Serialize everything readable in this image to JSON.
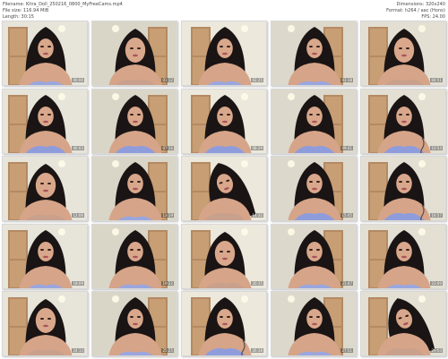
{
  "meta": {
    "filename": "Filename: Kitra_Doll_250216_0800_MyFreeCams.mp4",
    "filesize": "File size: 116.94 MiB",
    "length": "Length: 30:15",
    "dimensions": "Dimensions: 320x240",
    "format": "Format: h264 / aac (Hono)",
    "fps": "FPS: 24.00"
  },
  "thumbnails": [
    {
      "time": "00:00",
      "scene": "hair"
    },
    {
      "time": "01:12",
      "scene": "close"
    },
    {
      "time": "02:25",
      "scene": "room"
    },
    {
      "time": "03:38",
      "scene": "room"
    },
    {
      "time": "04:51",
      "scene": "close"
    },
    {
      "time": "06:03",
      "scene": "lace"
    },
    {
      "time": "07:16",
      "scene": "lace"
    },
    {
      "time": "08:29",
      "scene": "lace"
    },
    {
      "time": "09:41",
      "scene": "lace"
    },
    {
      "time": "10:54",
      "scene": "tattoo"
    },
    {
      "time": "12:06",
      "scene": "close"
    },
    {
      "time": "13:19",
      "scene": "room"
    },
    {
      "time": "14:32",
      "scene": "tilt"
    },
    {
      "time": "15:45",
      "scene": "lace"
    },
    {
      "time": "16:57",
      "scene": "tattoo"
    },
    {
      "time": "18:09",
      "scene": "hair"
    },
    {
      "time": "19:22",
      "scene": "room"
    },
    {
      "time": "20:35",
      "scene": "close"
    },
    {
      "time": "21:47",
      "scene": "room"
    },
    {
      "time": "23:00",
      "scene": "hair"
    },
    {
      "time": "24:13",
      "scene": "close"
    },
    {
      "time": "25:25",
      "scene": "room"
    },
    {
      "time": "26:38",
      "scene": "tattoo"
    },
    {
      "time": "27:51",
      "scene": "room"
    },
    {
      "time": "29:03",
      "scene": "tilt"
    }
  ]
}
